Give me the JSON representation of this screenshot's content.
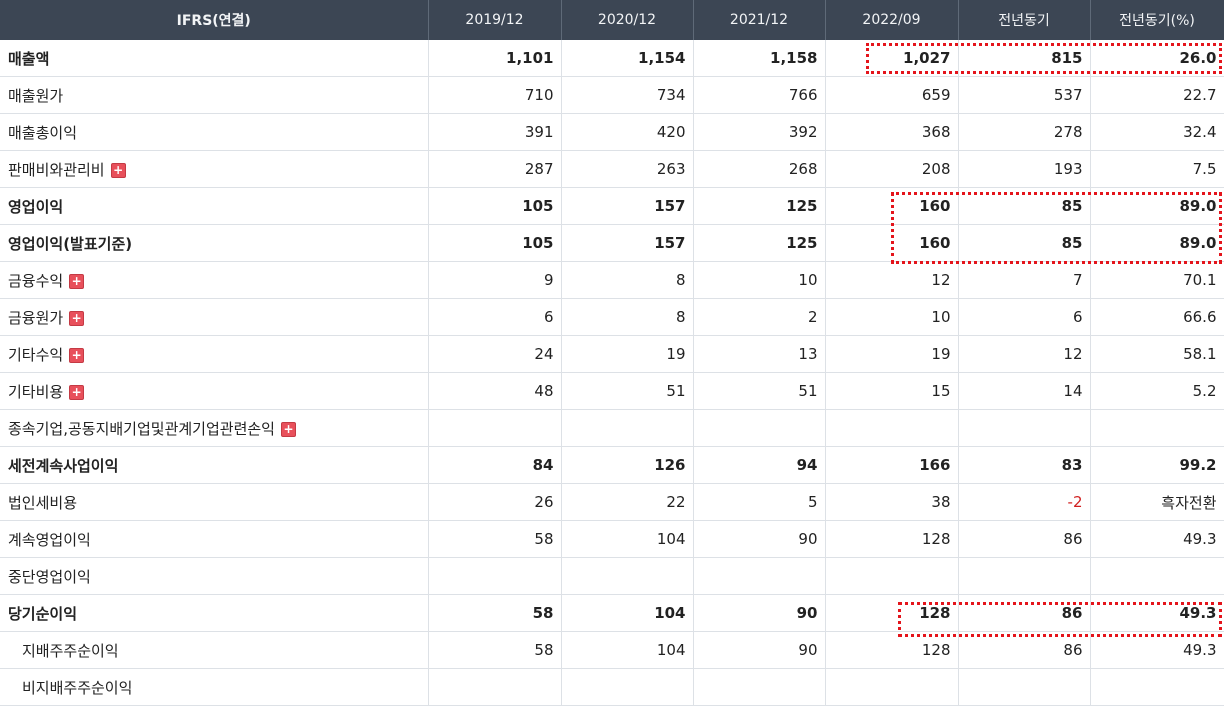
{
  "table": {
    "headers": [
      "IFRS(연결)",
      "2019/12",
      "2020/12",
      "2021/12",
      "2022/09",
      "전년동기",
      "전년동기(%)"
    ],
    "rows": [
      {
        "label": "매출액",
        "values": [
          "1,101",
          "1,154",
          "1,158",
          "1,027",
          "815",
          "26.0"
        ],
        "bold": true,
        "expandable": false
      },
      {
        "label": "매출원가",
        "values": [
          "710",
          "734",
          "766",
          "659",
          "537",
          "22.7"
        ],
        "bold": false,
        "expandable": false
      },
      {
        "label": "매출총이익",
        "values": [
          "391",
          "420",
          "392",
          "368",
          "278",
          "32.4"
        ],
        "bold": false,
        "expandable": false
      },
      {
        "label": "판매비와관리비",
        "values": [
          "287",
          "263",
          "268",
          "208",
          "193",
          "7.5"
        ],
        "bold": false,
        "expandable": true
      },
      {
        "label": "영업이익",
        "values": [
          "105",
          "157",
          "125",
          "160",
          "85",
          "89.0"
        ],
        "bold": true,
        "expandable": false
      },
      {
        "label": "영업이익(발표기준)",
        "values": [
          "105",
          "157",
          "125",
          "160",
          "85",
          "89.0"
        ],
        "bold": true,
        "expandable": false
      },
      {
        "label": "금융수익",
        "values": [
          "9",
          "8",
          "10",
          "12",
          "7",
          "70.1"
        ],
        "bold": false,
        "expandable": true
      },
      {
        "label": "금융원가",
        "values": [
          "6",
          "8",
          "2",
          "10",
          "6",
          "66.6"
        ],
        "bold": false,
        "expandable": true
      },
      {
        "label": "기타수익",
        "values": [
          "24",
          "19",
          "13",
          "19",
          "12",
          "58.1"
        ],
        "bold": false,
        "expandable": true
      },
      {
        "label": "기타비용",
        "values": [
          "48",
          "51",
          "51",
          "15",
          "14",
          "5.2"
        ],
        "bold": false,
        "expandable": true
      },
      {
        "label": "종속기업,공동지배기업및관계기업관련손익",
        "values": [
          "",
          "",
          "",
          "",
          "",
          ""
        ],
        "bold": false,
        "expandable": true
      },
      {
        "label": "세전계속사업이익",
        "values": [
          "84",
          "126",
          "94",
          "166",
          "83",
          "99.2"
        ],
        "bold": true,
        "expandable": false
      },
      {
        "label": "법인세비용",
        "values": [
          "26",
          "22",
          "5",
          "38",
          "-2",
          "흑자전환"
        ],
        "bold": false,
        "expandable": false
      },
      {
        "label": "계속영업이익",
        "values": [
          "58",
          "104",
          "90",
          "128",
          "86",
          "49.3"
        ],
        "bold": false,
        "expandable": false
      },
      {
        "label": "중단영업이익",
        "values": [
          "",
          "",
          "",
          "",
          "",
          ""
        ],
        "bold": false,
        "expandable": false
      },
      {
        "label": "당기순이익",
        "values": [
          "58",
          "104",
          "90",
          "128",
          "86",
          "49.3"
        ],
        "bold": true,
        "expandable": false
      },
      {
        "label": "지배주주순이익",
        "values": [
          "58",
          "104",
          "90",
          "128",
          "86",
          "49.3"
        ],
        "bold": false,
        "expandable": false
      },
      {
        "label": "비지배주주순이익",
        "values": [
          "",
          "",
          "",
          "",
          "",
          ""
        ],
        "bold": false,
        "expandable": false
      }
    ]
  },
  "colors": {
    "header_bg": "#3c4654",
    "highlight_border": "#e4141b",
    "negative_text": "#d11f1f",
    "expand_icon": "#e8505b"
  },
  "icons": {
    "expand": "plus-box-icon"
  },
  "expand_glyph": "+"
}
